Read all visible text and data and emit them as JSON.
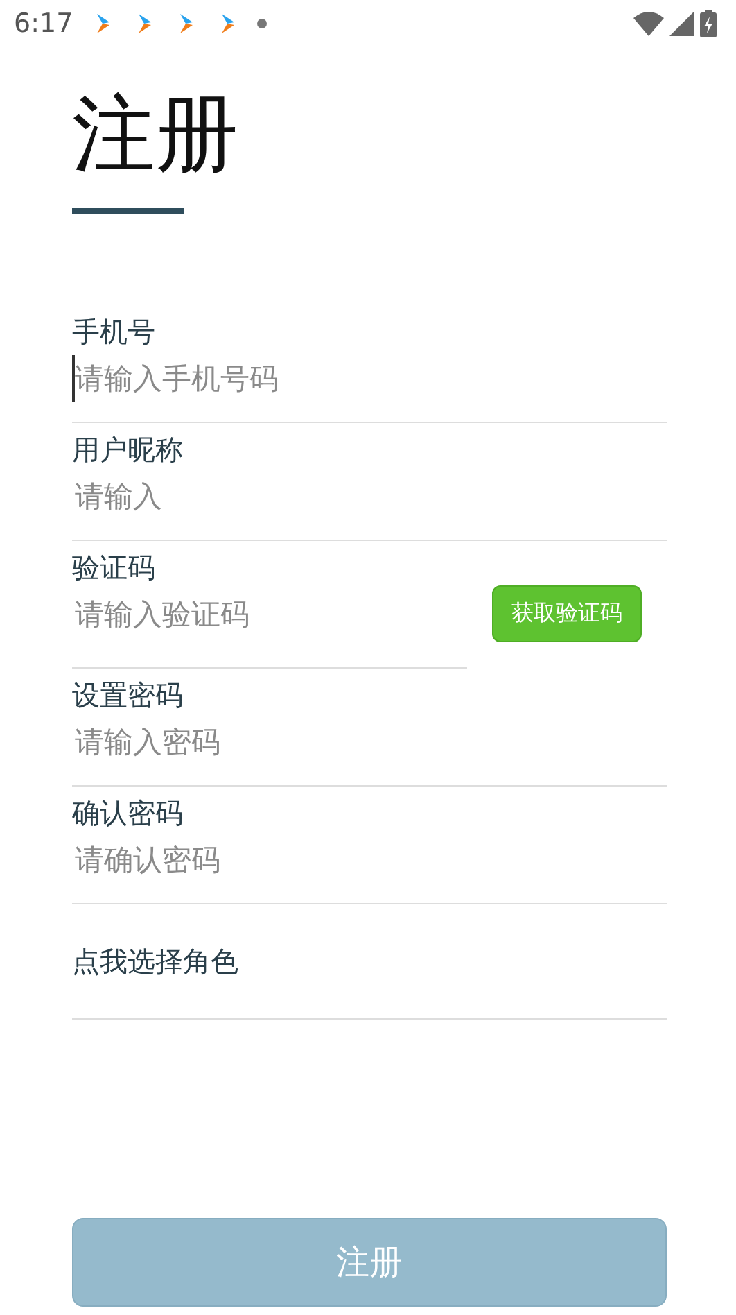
{
  "status_bar": {
    "time": "6:17",
    "notifications": [
      {
        "kind": "app"
      },
      {
        "kind": "app"
      },
      {
        "kind": "app"
      },
      {
        "kind": "app"
      },
      {
        "kind": "dot"
      }
    ]
  },
  "title": "注册",
  "fields": [
    {
      "kind": "text",
      "label": "手机号",
      "placeholder": "请输入手机号码",
      "focused": true
    },
    {
      "kind": "text",
      "label": "用户昵称",
      "placeholder": "请输入",
      "focused": false
    },
    {
      "kind": "code",
      "label": "验证码",
      "placeholder": "请输入验证码",
      "focused": false,
      "button": "获取验证码"
    },
    {
      "kind": "text",
      "label": "设置密码",
      "placeholder": "请输入密码",
      "focused": false
    },
    {
      "kind": "text",
      "label": "确认密码",
      "placeholder": "请确认密码",
      "focused": false
    }
  ],
  "role_picker": "点我选择角色",
  "submit": {
    "label": "注册",
    "disabled": true
  }
}
